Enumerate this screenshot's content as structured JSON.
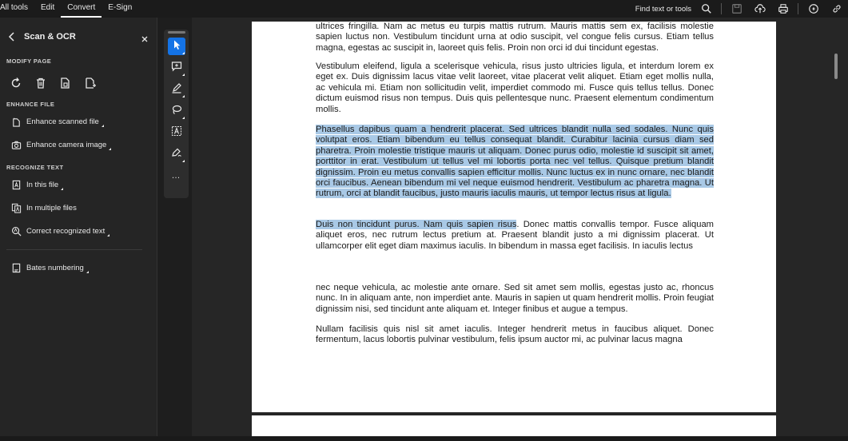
{
  "topbar": {
    "tabs": [
      "All tools",
      "Edit",
      "Convert",
      "E-Sign"
    ],
    "active_tab": "Convert",
    "find_label": "Find text or tools"
  },
  "panel": {
    "title": "Scan & OCR",
    "sections": {
      "modify": "MODIFY PAGE",
      "enhance": "ENHANCE FILE",
      "recognize": "RECOGNIZE TEXT"
    },
    "items": {
      "enhance_scanned": "Enhance scanned file",
      "enhance_camera": "Enhance camera image",
      "in_this_file": "In this file",
      "in_multiple_files": "In multiple files",
      "correct_text": "Correct recognized text",
      "bates": "Bates numbering"
    }
  },
  "document": {
    "p1": "ultrices fringilla. Nam ac metus eu turpis mattis rutrum. Mauris mattis sem ex, facilisis molestie sapien luctus non. Vestibulum tincidunt urna at odio suscipit, vel congue felis cursus. Etiam tellus magna, egestas ac suscipit in, laoreet quis felis. Proin non orci id dui tincidunt egestas.",
    "p2": "Vestibulum eleifend, ligula a scelerisque vehicula, risus justo ultricies ligula, et interdum lorem ex eget ex. Duis dignissim lacus vitae velit laoreet, vitae placerat velit aliquet. Etiam eget mollis nulla, ac vehicula mi. Etiam non sollicitudin velit, imperdiet commodo mi. Fusce quis tellus tellus. Donec dictum euismod risus non tempus. Duis quis pellentesque nunc. Praesent elementum condimentum mollis.",
    "p3": "Phasellus dapibus quam a hendrerit placerat. Sed ultrices blandit nulla sed sodales. Nunc quis volutpat eros. Etiam bibendum eu tellus consequat blandit. Curabitur lacinia cursus diam sed pharetra. Proin molestie tristique mauris ut aliquam. Donec purus odio, molestie id suscipit sit amet, porttitor in erat. Vestibulum ut tellus vel mi lobortis porta nec vel tellus. Quisque pretium blandit dignissim. Proin eu metus convallis sapien efficitur mollis. Nunc luctus ex in nunc ornare, nec blandit orci faucibus. Aenean bibendum mi vel neque euismod hendrerit. Vestibulum ac pharetra magna. Ut rutrum, orci at blandit faucibus, justo mauris iaculis mauris, ut tempor lectus risus at ligula.",
    "p4_highlight": "Duis non tincidunt purus. Nam quis sapien risus",
    "p4_rest": ". Donec mattis convallis tempor. Fusce aliquam aliquet eros, nec rutrum lectus pretium at. Praesent blandit justo a mi dignissim placerat. Ut ullamcorper elit eget diam maximus iaculis. In bibendum in massa eget facilisis. In iaculis lectus",
    "p5": "nec neque vehicula, ac molestie ante ornare. Sed sit amet sem mollis, egestas justo ac, rhoncus nunc. In in aliquam ante, non imperdiet ante. Mauris in sapien ut quam hendrerit mollis. Proin feugiat dignissim nisi, sed tincidunt ante aliquam et. Integer finibus et augue a tempus.",
    "p6": "Nullam facilisis quis nisl sit amet iaculis. Integer hendrerit metus in faucibus aliquet. Donec fermentum, lacus lobortis pulvinar vestibulum, felis ipsum auctor mi, ac pulvinar lacus magna"
  },
  "colors": {
    "accent": "#1473e6",
    "highlight": "#a9c9e6",
    "panel_bg": "#252525",
    "topbar_bg": "#1b1b1b"
  },
  "icons": [
    "search-icon",
    "save-icon",
    "upload-cloud-icon",
    "print-icon",
    "ai-assistant-icon",
    "link-icon",
    "back-chevron-icon",
    "close-icon",
    "rotate-icon",
    "delete-icon",
    "extract-page-icon",
    "insert-page-icon",
    "enhance-scanned-icon",
    "camera-icon",
    "text-file-icon",
    "multiple-files-icon",
    "correct-text-icon",
    "bates-icon",
    "select-cursor-icon",
    "comment-icon",
    "highlight-pen-icon",
    "lasso-icon",
    "text-box-icon",
    "sign-icon"
  ]
}
